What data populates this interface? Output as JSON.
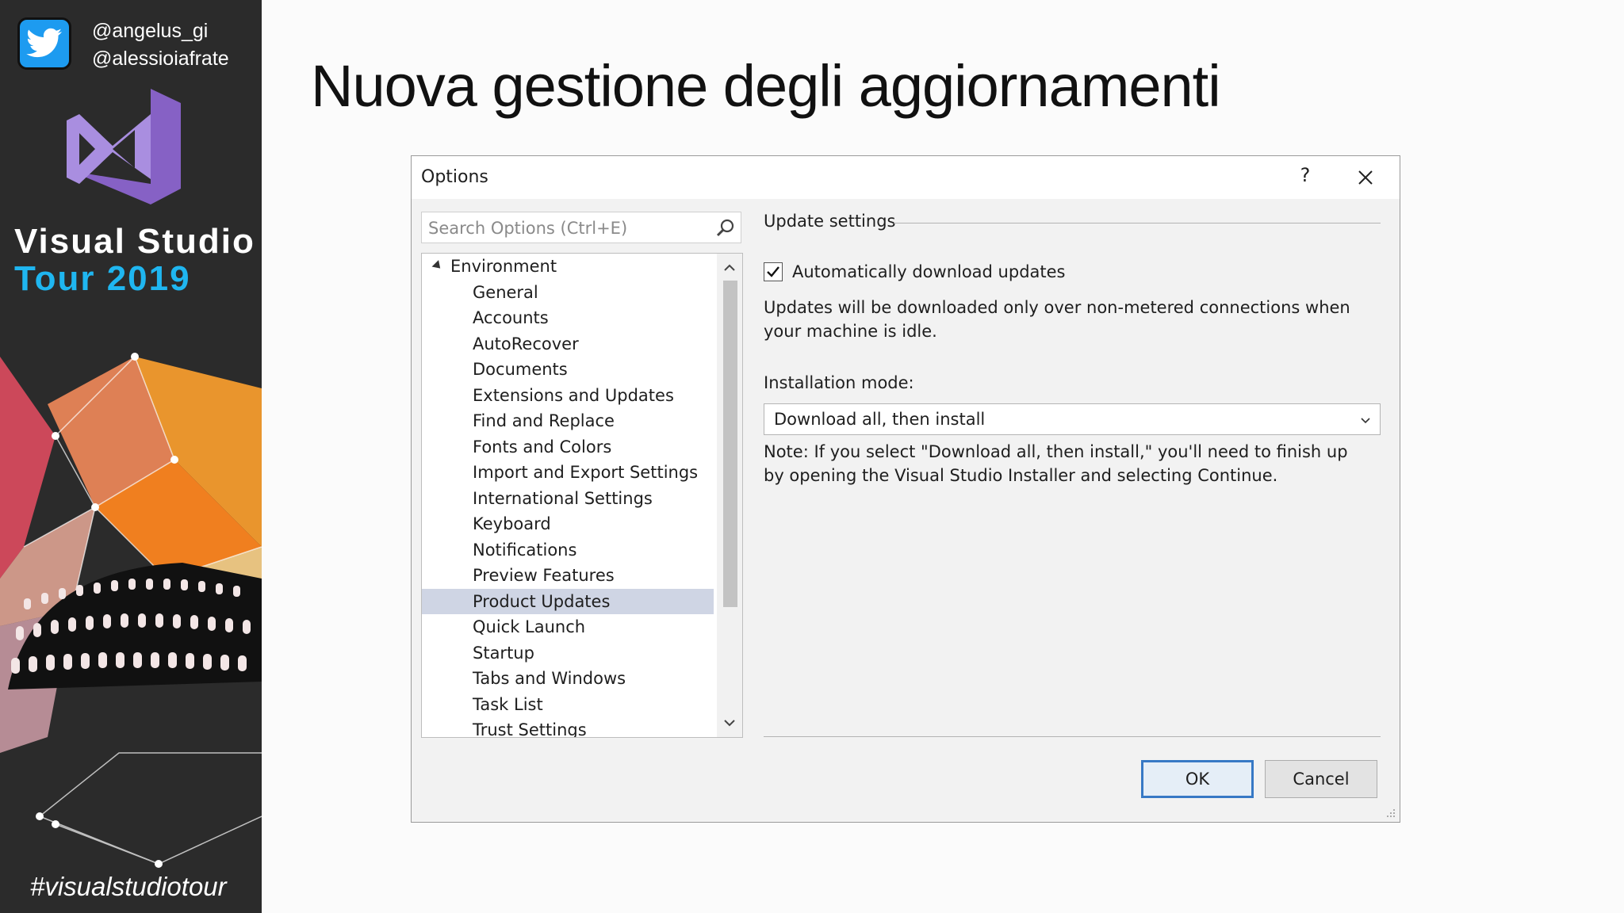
{
  "sidebar": {
    "handles": [
      "@angelus_gi",
      "@alessioiafrate"
    ],
    "title_line1": "Visual Studio",
    "title_line2": "Tour 2019",
    "hashtag": "#visualstudiotour",
    "icons": [
      "twitter-bird-icon",
      "visual-studio-logo-icon"
    ],
    "colors": {
      "background": "#2b2b2b",
      "twitter_blue": "#1d9bf0",
      "accent_blue": "#1fb6f0",
      "vs_purple": "#8661c5"
    }
  },
  "slide": {
    "title": "Nuova gestione degli aggiornamenti"
  },
  "dialog": {
    "title": "Options",
    "help_label": "?",
    "search": {
      "placeholder": "Search Options (Ctrl+E)",
      "value": ""
    },
    "tree": {
      "root": "Environment",
      "items": [
        "General",
        "Accounts",
        "AutoRecover",
        "Documents",
        "Extensions and Updates",
        "Find and Replace",
        "Fonts and Colors",
        "Import and Export Settings",
        "International Settings",
        "Keyboard",
        "Notifications",
        "Preview Features",
        "Product Updates",
        "Quick Launch",
        "Startup",
        "Tabs and Windows",
        "Task List",
        "Trust Settings"
      ],
      "selected": "Product Updates"
    },
    "section_header": "Update settings",
    "auto_download": {
      "label": "Automatically download updates",
      "checked": true
    },
    "description": "Updates will be downloaded only over non-metered connections when your machine is idle.",
    "installation_mode": {
      "label": "Installation mode:",
      "value": "Download all, then install"
    },
    "note": "Note: If you select \"Download all, then install,\" you'll need to finish up by opening the Visual Studio Installer and selecting Continue.",
    "buttons": {
      "ok": "OK",
      "cancel": "Cancel"
    },
    "colors": {
      "selection": "#cfd5e4",
      "ok_border": "#3779c5"
    }
  }
}
